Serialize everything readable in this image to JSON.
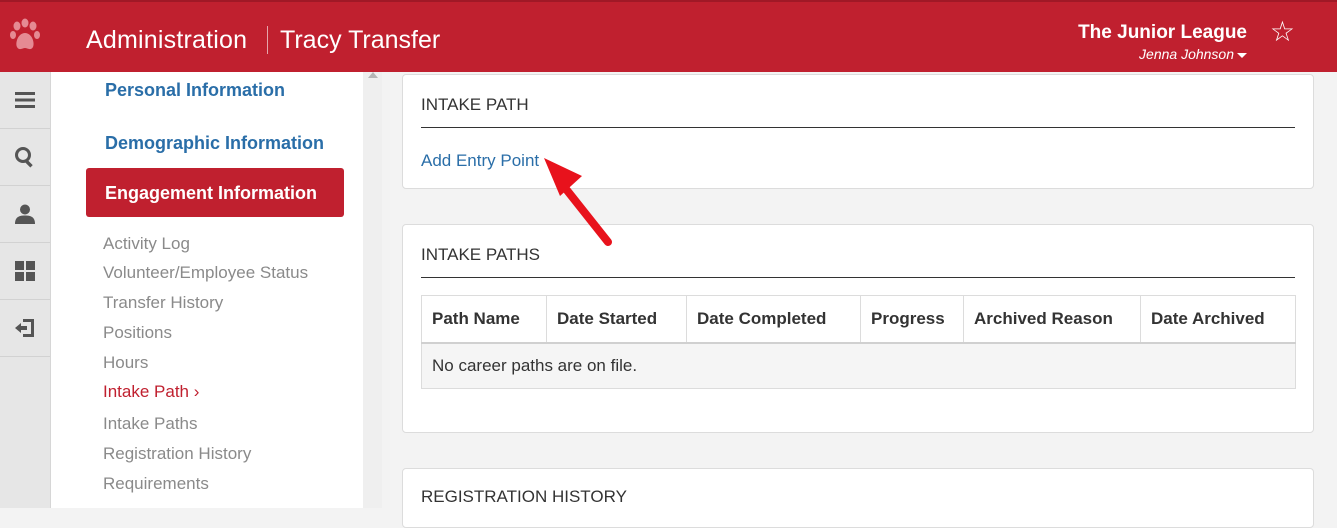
{
  "header": {
    "section_title": "Administration",
    "person_name": "Tracy Transfer",
    "org_name": "The Junior League",
    "user_name": "Jenna Johnson"
  },
  "rail": {
    "items": [
      "menu-icon",
      "search-icon",
      "user-icon",
      "dashboard-icon",
      "logout-icon"
    ]
  },
  "sidenav": {
    "personal": "Personal Information",
    "demographic": "Demographic Information",
    "engagement": "Engagement Information",
    "sub_items": [
      "Activity Log",
      "Volunteer/Employee Status",
      "Transfer History",
      "Positions",
      "Hours",
      "Intake Path ›",
      "Intake Paths",
      "Registration History",
      "Requirements"
    ]
  },
  "intake_path": {
    "title": "INTAKE PATH",
    "add_link": "Add Entry Point"
  },
  "intake_paths": {
    "title": "INTAKE PATHS",
    "columns": [
      "Path Name",
      "Date Started",
      "Date Completed",
      "Progress",
      "Archived Reason",
      "Date Archived"
    ],
    "empty_message": "No career paths are on file."
  },
  "registration_history": {
    "title": "REGISTRATION HISTORY"
  },
  "colors": {
    "brand_red": "#c0202f",
    "link_blue": "#2a6ea8",
    "arrow_red": "#e8121c"
  }
}
